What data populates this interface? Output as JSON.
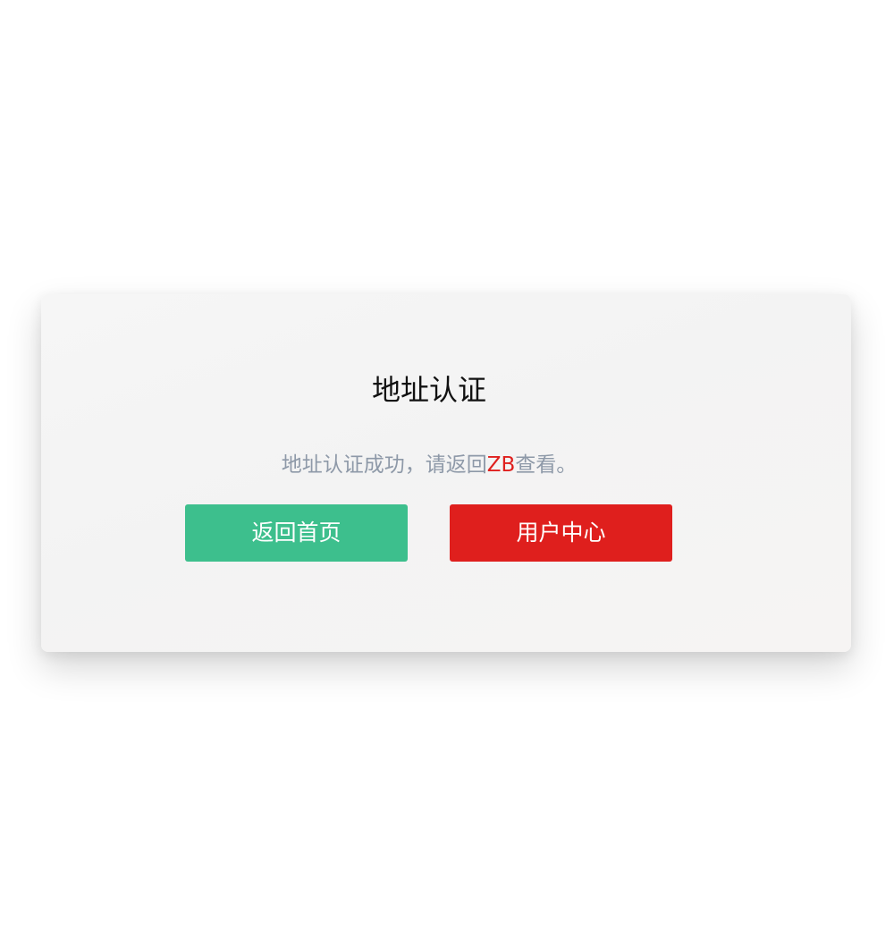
{
  "card": {
    "title": "地址认证",
    "message": {
      "prefix": "地址认证成功，请返回",
      "highlight": "ZB",
      "suffix": "查看。"
    },
    "buttons": {
      "home_label": "返回首页",
      "user_center_label": "用户中心"
    }
  },
  "colors": {
    "title": "#111111",
    "message": "#8e99a8",
    "highlight": "#df1f1d",
    "home_button": "#3dbf8d",
    "user_center_button": "#df1f1d"
  }
}
